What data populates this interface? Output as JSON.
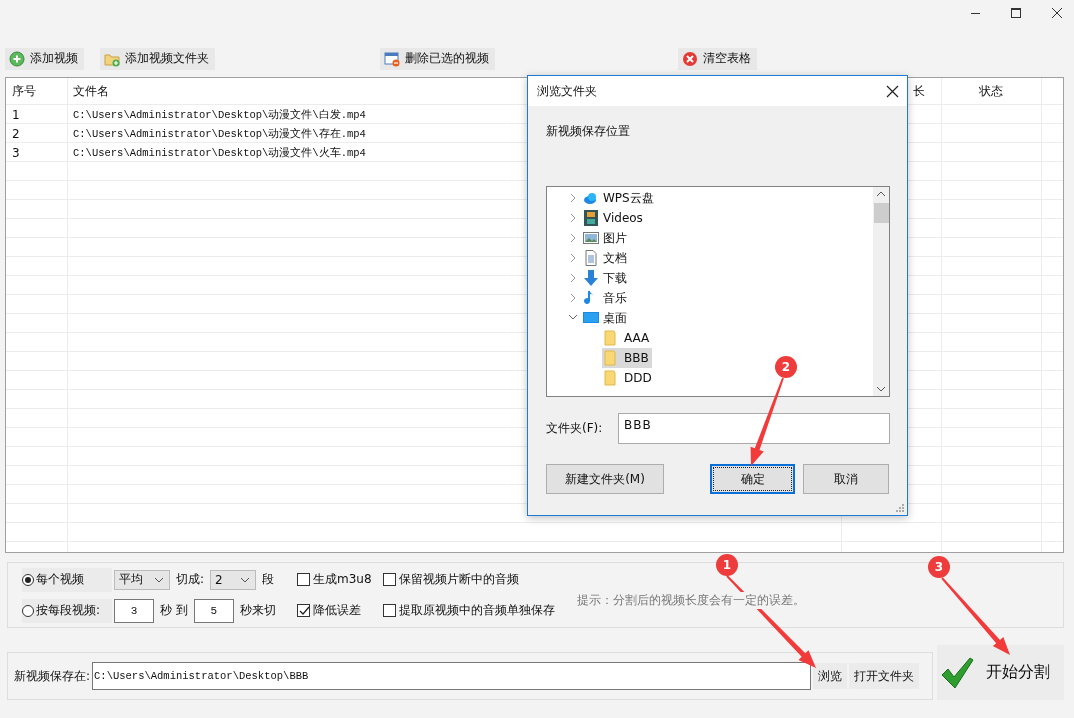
{
  "toolbar": [
    {
      "label": "添加视频",
      "kind": "add"
    },
    {
      "label": "添加视频文件夹",
      "kind": "folder-add"
    },
    {
      "label": "删除已选的视频",
      "kind": "remove"
    },
    {
      "label": "清空表格",
      "kind": "clear"
    }
  ],
  "table": {
    "columns": [
      "序号",
      "文件名",
      "长",
      "状态"
    ],
    "rows": [
      [
        "1",
        "C:\\Users\\Administrator\\Desktop\\动漫文件\\白发.mp4"
      ],
      [
        "2",
        "C:\\Users\\Administrator\\Desktop\\动漫文件\\存在.mp4"
      ],
      [
        "3",
        "C:\\Users\\Administrator\\Desktop\\动漫文件\\火车.mp4"
      ]
    ]
  },
  "options": {
    "mode": [
      {
        "label": "每个视频",
        "selected": true
      },
      {
        "label": "按每段视频:",
        "selected": false
      }
    ],
    "method": "平均",
    "cut_label": "切成:",
    "segments": "2",
    "segments_unit": "段",
    "from": "3",
    "sec_to": "秒 到",
    "to": "5",
    "sec_cut": "秒来切",
    "checks": [
      {
        "label": "生成m3u8",
        "checked": false
      },
      {
        "label": "保留视频片断中的音频",
        "checked": false
      },
      {
        "label": "降低误差",
        "checked": true
      },
      {
        "label": "提取原视频中的音频单独保存",
        "checked": false
      }
    ],
    "hint": "提示：分割后的视频长度会有一定的误差。"
  },
  "save": {
    "label": "新视频保存在:",
    "path": "C:\\Users\\Administrator\\Desktop\\BBB",
    "buttons": [
      "浏览",
      "打开文件夹"
    ]
  },
  "start_button": {
    "label": "开始分割"
  },
  "dialog": {
    "title": "浏览文件夹",
    "prompt": "新视频保存位置",
    "tree": [
      {
        "label": "WPS云盘",
        "kind": "cloud",
        "expanded": false,
        "selected": false
      },
      {
        "label": "Videos",
        "kind": "film",
        "expanded": false,
        "selected": false
      },
      {
        "label": "图片",
        "kind": "image",
        "expanded": false,
        "selected": false
      },
      {
        "label": "文档",
        "kind": "document",
        "expanded": false,
        "selected": false
      },
      {
        "label": "下载",
        "kind": "download",
        "expanded": false,
        "selected": false
      },
      {
        "label": "音乐",
        "kind": "music",
        "expanded": false,
        "selected": false
      },
      {
        "label": "桌面",
        "kind": "desktop",
        "expanded": true,
        "selected": false,
        "children": [
          {
            "label": "AAA",
            "kind": "folder",
            "selected": false
          },
          {
            "label": "BBB",
            "kind": "folder",
            "selected": true
          },
          {
            "label": "DDD",
            "kind": "folder",
            "selected": false
          }
        ]
      }
    ],
    "folder_label": "文件夹(F):",
    "folder_value": "BBB",
    "buttons": [
      {
        "label": "新建文件夹(M)",
        "focused": false
      },
      {
        "label": "确定",
        "focused": true
      },
      {
        "label": "取消",
        "focused": false
      }
    ]
  },
  "annotations": [
    {
      "number": "1"
    },
    {
      "number": "2"
    },
    {
      "number": "3"
    }
  ]
}
